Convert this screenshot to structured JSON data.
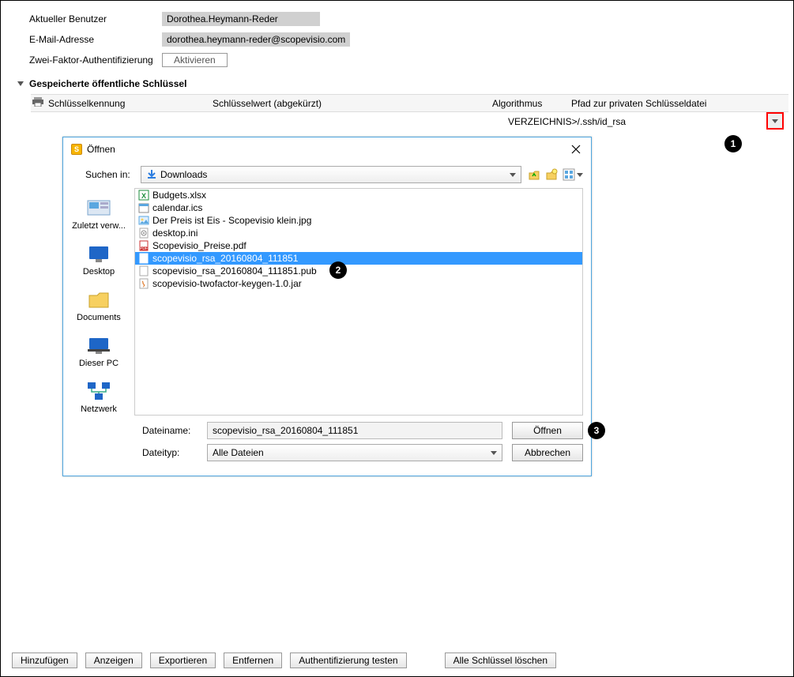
{
  "form": {
    "user_label": "Aktueller Benutzer",
    "user_value": "Dorothea.Heymann-Reder",
    "email_label": "E-Mail-Adresse",
    "email_value": "dorothea.heymann-reder@scopevisio.com",
    "twofa_label": "Zwei-Faktor-Authentifizierung",
    "twofa_button": "Aktivieren"
  },
  "section_title": "Gespeicherte öffentliche Schlüssel",
  "grid": {
    "col1": "Schlüsselkennung",
    "col2": "Schlüsselwert (abgekürzt)",
    "col3": "Algorithmus",
    "col4": "Pfad zur privaten Schlüsseldatei",
    "row_path": "VERZEICHNIS>/.ssh/id_rsa"
  },
  "dialog": {
    "title": "Öffnen",
    "search_label": "Suchen in:",
    "search_value": "Downloads",
    "places": {
      "recent": "Zuletzt verw...",
      "desktop": "Desktop",
      "documents": "Documents",
      "pc": "Dieser PC",
      "network": "Netzwerk"
    },
    "files": [
      {
        "name": "Budgets.xlsx",
        "icon": "excel"
      },
      {
        "name": "calendar.ics",
        "icon": "cal"
      },
      {
        "name": "Der Preis ist Eis - Scopevisio klein.jpg",
        "icon": "img"
      },
      {
        "name": "desktop.ini",
        "icon": "ini"
      },
      {
        "name": "Scopevisio_Preise.pdf",
        "icon": "pdf"
      },
      {
        "name": "scopevisio_rsa_20160804_111851",
        "icon": "blank",
        "selected": true
      },
      {
        "name": "scopevisio_rsa_20160804_111851.pub",
        "icon": "blank"
      },
      {
        "name": "scopevisio-twofactor-keygen-1.0.jar",
        "icon": "jar"
      }
    ],
    "filename_label": "Dateiname:",
    "filename_value": "scopevisio_rsa_20160804_111851",
    "filetype_label": "Dateityp:",
    "filetype_value": "Alle Dateien",
    "open_btn": "Öffnen",
    "cancel_btn": "Abbrechen"
  },
  "footer": {
    "add": "Hinzufügen",
    "show": "Anzeigen",
    "export": "Exportieren",
    "remove": "Entfernen",
    "test": "Authentifizierung testen",
    "delall": "Alle Schlüssel löschen"
  },
  "badges": {
    "b1": "1",
    "b2": "2",
    "b3": "3"
  }
}
